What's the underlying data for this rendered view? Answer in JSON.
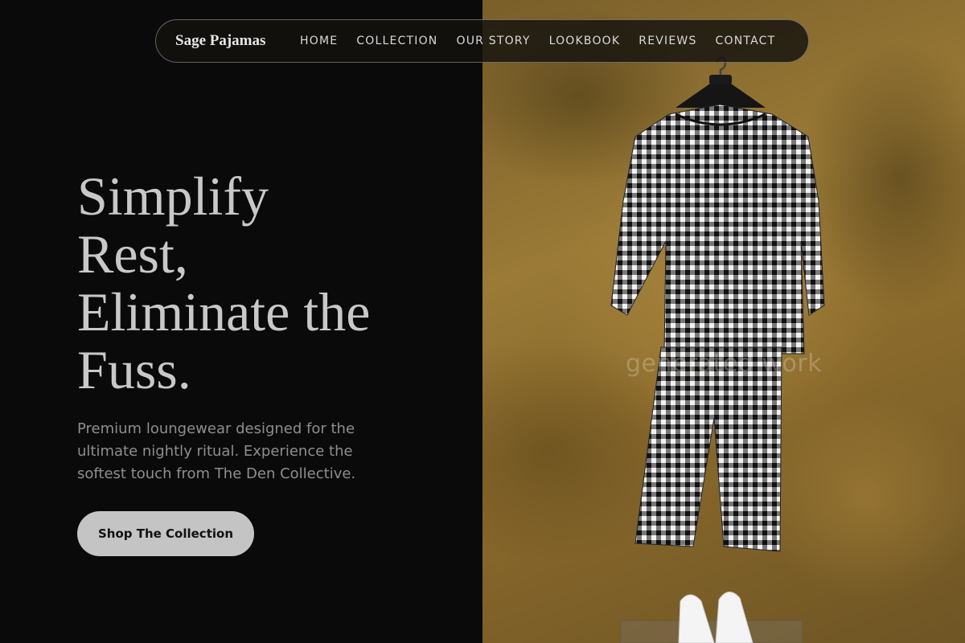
{
  "nav": {
    "brand": "Sage Pajamas",
    "links": [
      "HOME",
      "COLLECTION",
      "OUR STORY",
      "LOOKBOOK",
      "REVIEWS",
      "CONTACT"
    ]
  },
  "hero": {
    "title_lines": [
      "Simplify",
      "Rest,",
      "Eliminate the",
      "Fuss."
    ],
    "subtitle_lines": [
      "Premium loungewear designed for the",
      "ultimate nightly ritual. Experience the",
      "softest touch from The Den Collective."
    ],
    "cta_label": "Shop The Collection"
  },
  "image": {
    "watermark": "generated work",
    "description_icon": "gingham-pajama-set-on-hanger"
  },
  "colors": {
    "background": "#0a0a0a",
    "title": "#c8c8c8",
    "subtitle": "#8e8e8e",
    "cta_bg": "#c4c4c4",
    "wall_gold": "#9a7a36"
  }
}
